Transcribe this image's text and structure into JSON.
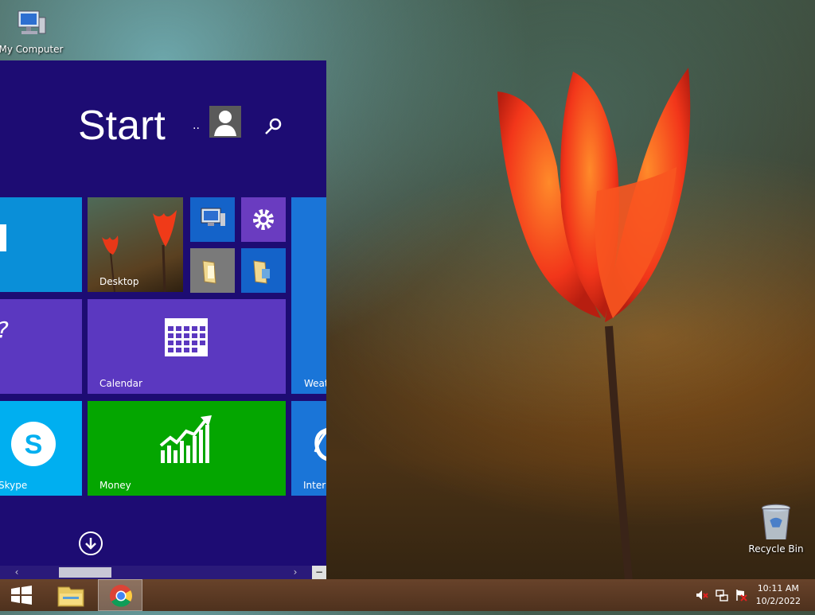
{
  "desktop": {
    "icons": [
      {
        "label": "My Computer"
      },
      {
        "label": "Recycle Bin"
      }
    ]
  },
  "start": {
    "title": "Start",
    "user_dots": "..",
    "tiles": [
      {
        "label": "Desktop"
      },
      {
        "label": "Calendar"
      },
      {
        "label": "Skype"
      },
      {
        "label": "Money"
      },
      {
        "label": "Weat"
      },
      {
        "label": "Intern"
      }
    ]
  },
  "taskbar": {
    "clock_time": "10:11 AM",
    "clock_date": "10/2/2022"
  },
  "colors": {
    "start_bg": "#1d0c73",
    "tile_blue": "#0a8fd8",
    "tile_purple": "#5b38c0",
    "tile_green": "#04a600",
    "tile_skype": "#00aff0"
  }
}
